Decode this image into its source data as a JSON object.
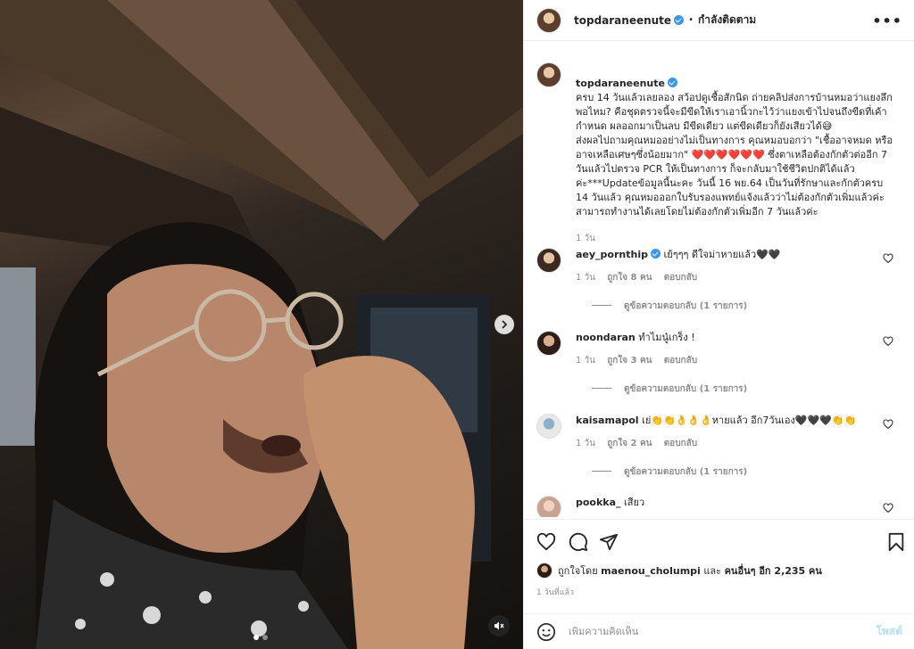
{
  "header": {
    "username": "topdaraneenute",
    "separator": "•",
    "follow_status": "กำลังติดตาม",
    "more_icon": "more-horizontal-icon"
  },
  "caption": {
    "username": "topdaraneenute",
    "text": "ครบ 14 วันแล้วเลยลอง สว้อปดูเชื้อสักนิด ถ่ายคลิปส่งการบ้านหมอว่าแยงลึกพอไหม? คือชุดตรวจนี้จะมีขีดให้เราเอานิ้วกะไว้ว่าแยงเข้าไปจนถึงขีดที่เค้ากำหนด ผลออกมาเป็นลบ มีขีดเดียว แต่ขีดเดียวก็ยังเสียวได้😅\nส่งผลไปถามคุณหมออย่างไม่เป็นทางการ คุณหมอบอกว่า \"เชื้ออาจหมด หรืออาจเหลือเศษๆซึ่งน้อยมาก\" ❤️❤️❤️❤️❤️❤️ ซึ่งตาเหลือต้องกักตัวต่ออีก 7 วันแล้วไปตรวจ PCR ให้เป็นทางการ ก็จะกลับมาใช้ชีวิตปกติได้แล้วค่ะ***Updateข้อมูลนี้นะคะ วันนี้ 16 พย.64 เป็นวันที่รักษาและกักตัวครบ 14 วันแล้ว คุณหมอออกใบรับรองแพทย์แจ้งแล้วว่าไม่ต้องกักตัวเพิ่มแล้วค่ะ สามารถทำงานได้เลยโดยไม่ต้องกักตัวเพิ่มอีก 7 วันแล้วค่ะ",
    "time": "1 วัน"
  },
  "comments": [
    {
      "username": "aey_pornthip",
      "verified": true,
      "text": "เย้ๆๆๆ ดีใจม่าหายแล้ว🖤🖤",
      "time": "1 วัน",
      "likes": "ถูกใจ 8 คน",
      "reply": "ตอบกลับ",
      "replies": "ดูข้อความตอบกลับ (1 รายการ)"
    },
    {
      "username": "noondaran",
      "verified": false,
      "text": "ทำไมนู๋เกร็ง !",
      "time": "1 วัน",
      "likes": "ถูกใจ 3 คน",
      "reply": "ตอบกลับ",
      "replies": "ดูข้อความตอบกลับ (1 รายการ)"
    },
    {
      "username": "kaisamapol",
      "verified": false,
      "text": "เย่👏👏👌👌👌หายแล้ว อีก7วันเอง🖤🖤🖤👏👏",
      "time": "1 วัน",
      "likes": "ถูกใจ 2 คน",
      "reply": "ตอบกลับ",
      "replies": "ดูข้อความตอบกลับ (1 รายการ)"
    },
    {
      "username": "pookka_",
      "verified": false,
      "text": "เสียว"
    }
  ],
  "likes_summary": {
    "prefix": "ถูกใจโดย",
    "user": "maenou_cholumpi",
    "and": "และ",
    "others": "คนอื่นๆ อีก 2,235 คน"
  },
  "posted_ago": "1 วันที่แล้ว",
  "add_comment": {
    "placeholder": "เพิ่มความคิดเห็น",
    "post_label": "โพสต์"
  },
  "colors": {
    "verified": "#3897f0",
    "post_disabled": "#b2dffc",
    "muted_text": "#8e8e8e"
  },
  "carousel": {
    "current": 1,
    "total": 2
  }
}
